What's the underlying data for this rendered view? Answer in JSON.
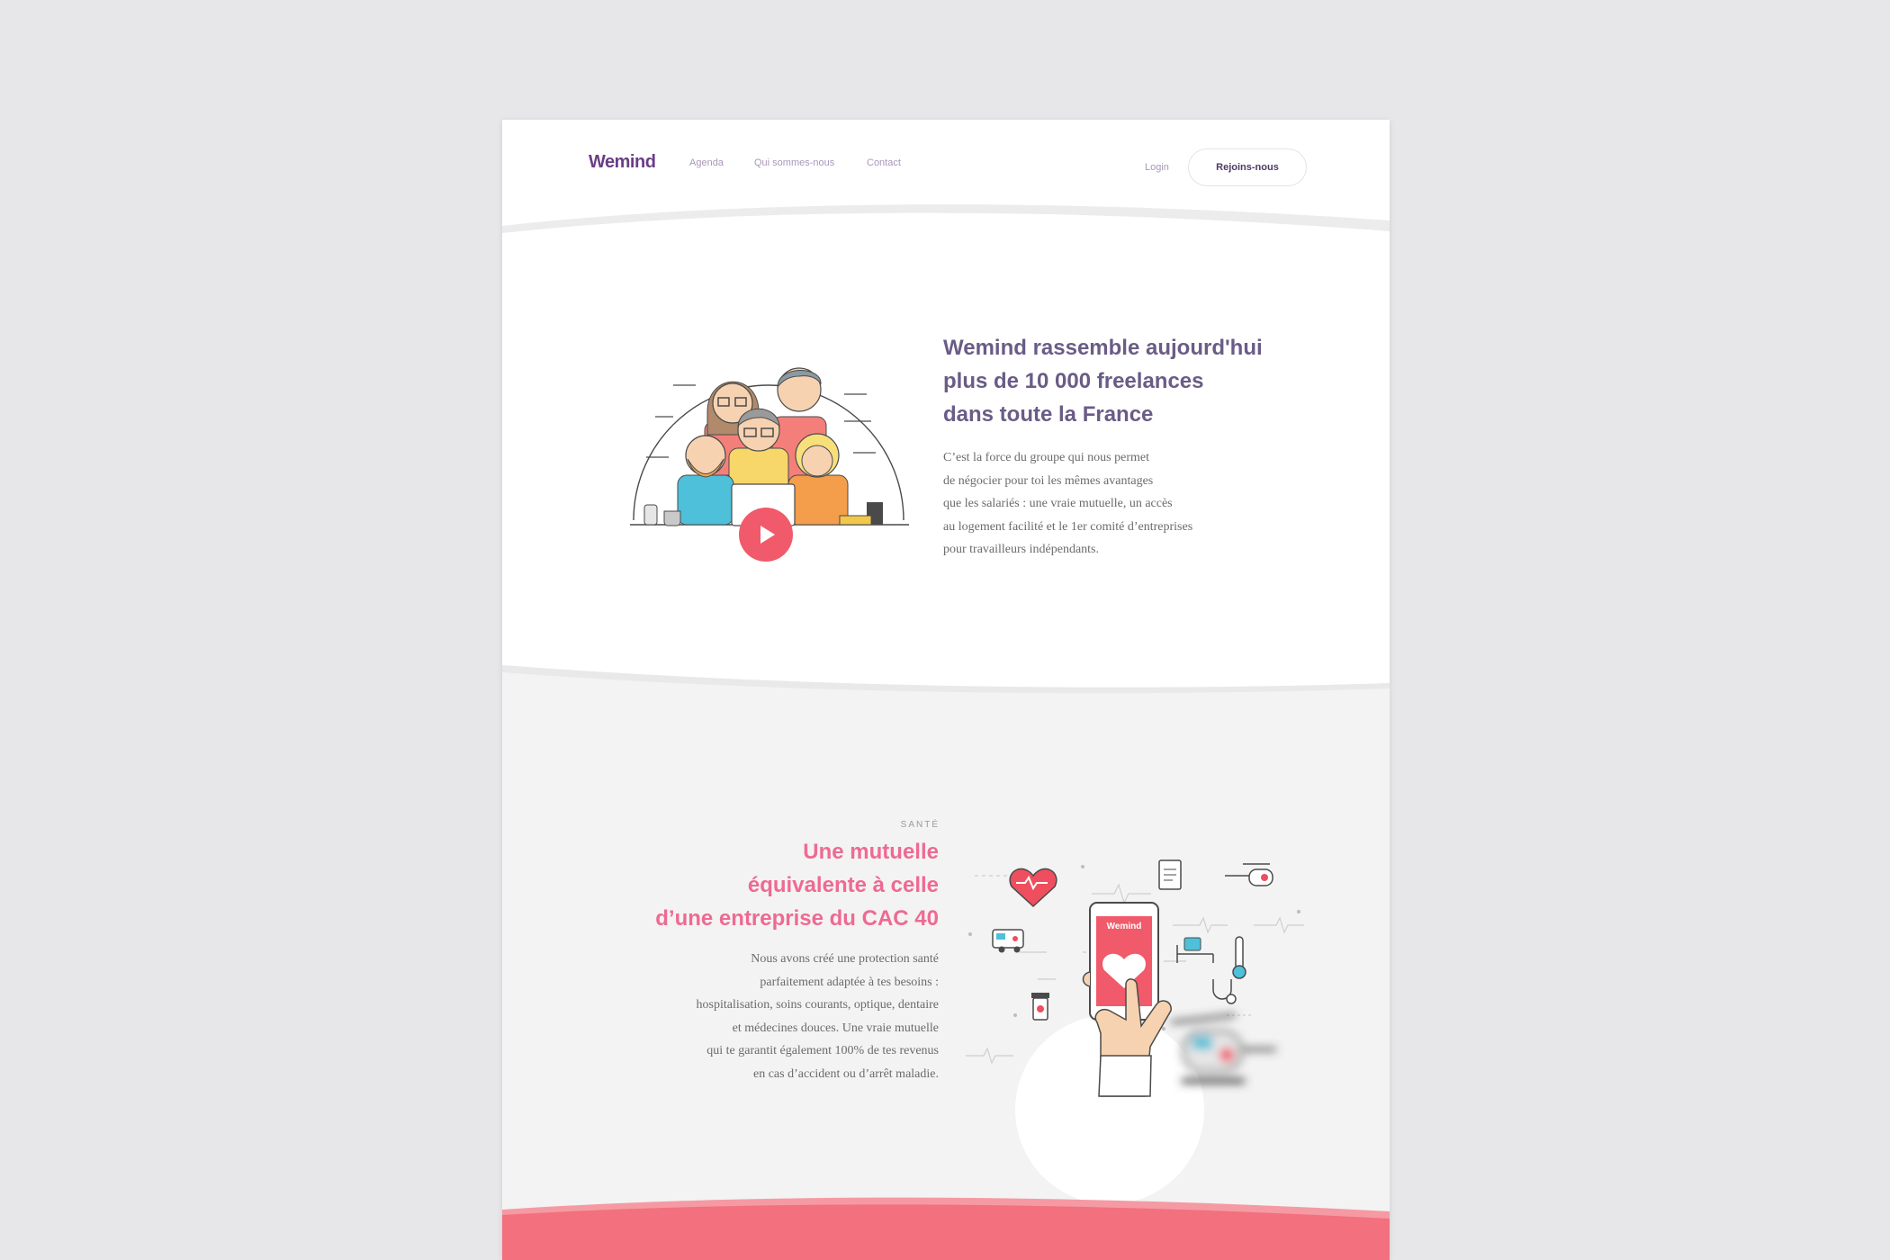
{
  "header": {
    "logo": "Wemind",
    "nav": [
      "Agenda",
      "Qui sommes-nous",
      "Contact"
    ],
    "login": "Login",
    "cta": "Rejoins-nous"
  },
  "intro": {
    "title_lines": [
      "Wemind rassemble aujourd'hui",
      "plus de 10 000 freelances",
      "dans toute la France"
    ],
    "body_lines": [
      "C’est la force du groupe qui nous permet",
      "de négocier pour toi les mêmes avantages",
      "que les salariés : une vraie mutuelle, un accès",
      "au logement facilité et le 1er comité d’entreprises",
      "pour travailleurs indépendants."
    ],
    "video_button": "play-icon"
  },
  "sante": {
    "kicker": "SANTÉ",
    "title_lines": [
      "Une mutuelle",
      "équivalente à celle",
      "d’une entreprise du CAC 40"
    ],
    "body_lines": [
      "Nous avons créé une protection santé",
      "parfaitement adaptée à tes besoins :",
      "hospitalisation, soins courants, optique, dentaire",
      "et médecines douces. Une vraie mutuelle",
      "qui te garantit également 100% de tes revenus",
      "en cas d’accident ou d’arrêt maladie."
    ],
    "phone_logo": "Wemind",
    "icons": [
      "heart-icon",
      "document-icon",
      "helicopter-icon",
      "ambulance-icon",
      "thermometer-icon",
      "bed-icon",
      "pill-bottle-icon",
      "stethoscope-icon"
    ]
  },
  "colors": {
    "brand_purple": "#6a3e86",
    "heading_purple": "#6a5c86",
    "accent_pink": "#ee6a93",
    "bottom_coral": "#f3707e"
  }
}
